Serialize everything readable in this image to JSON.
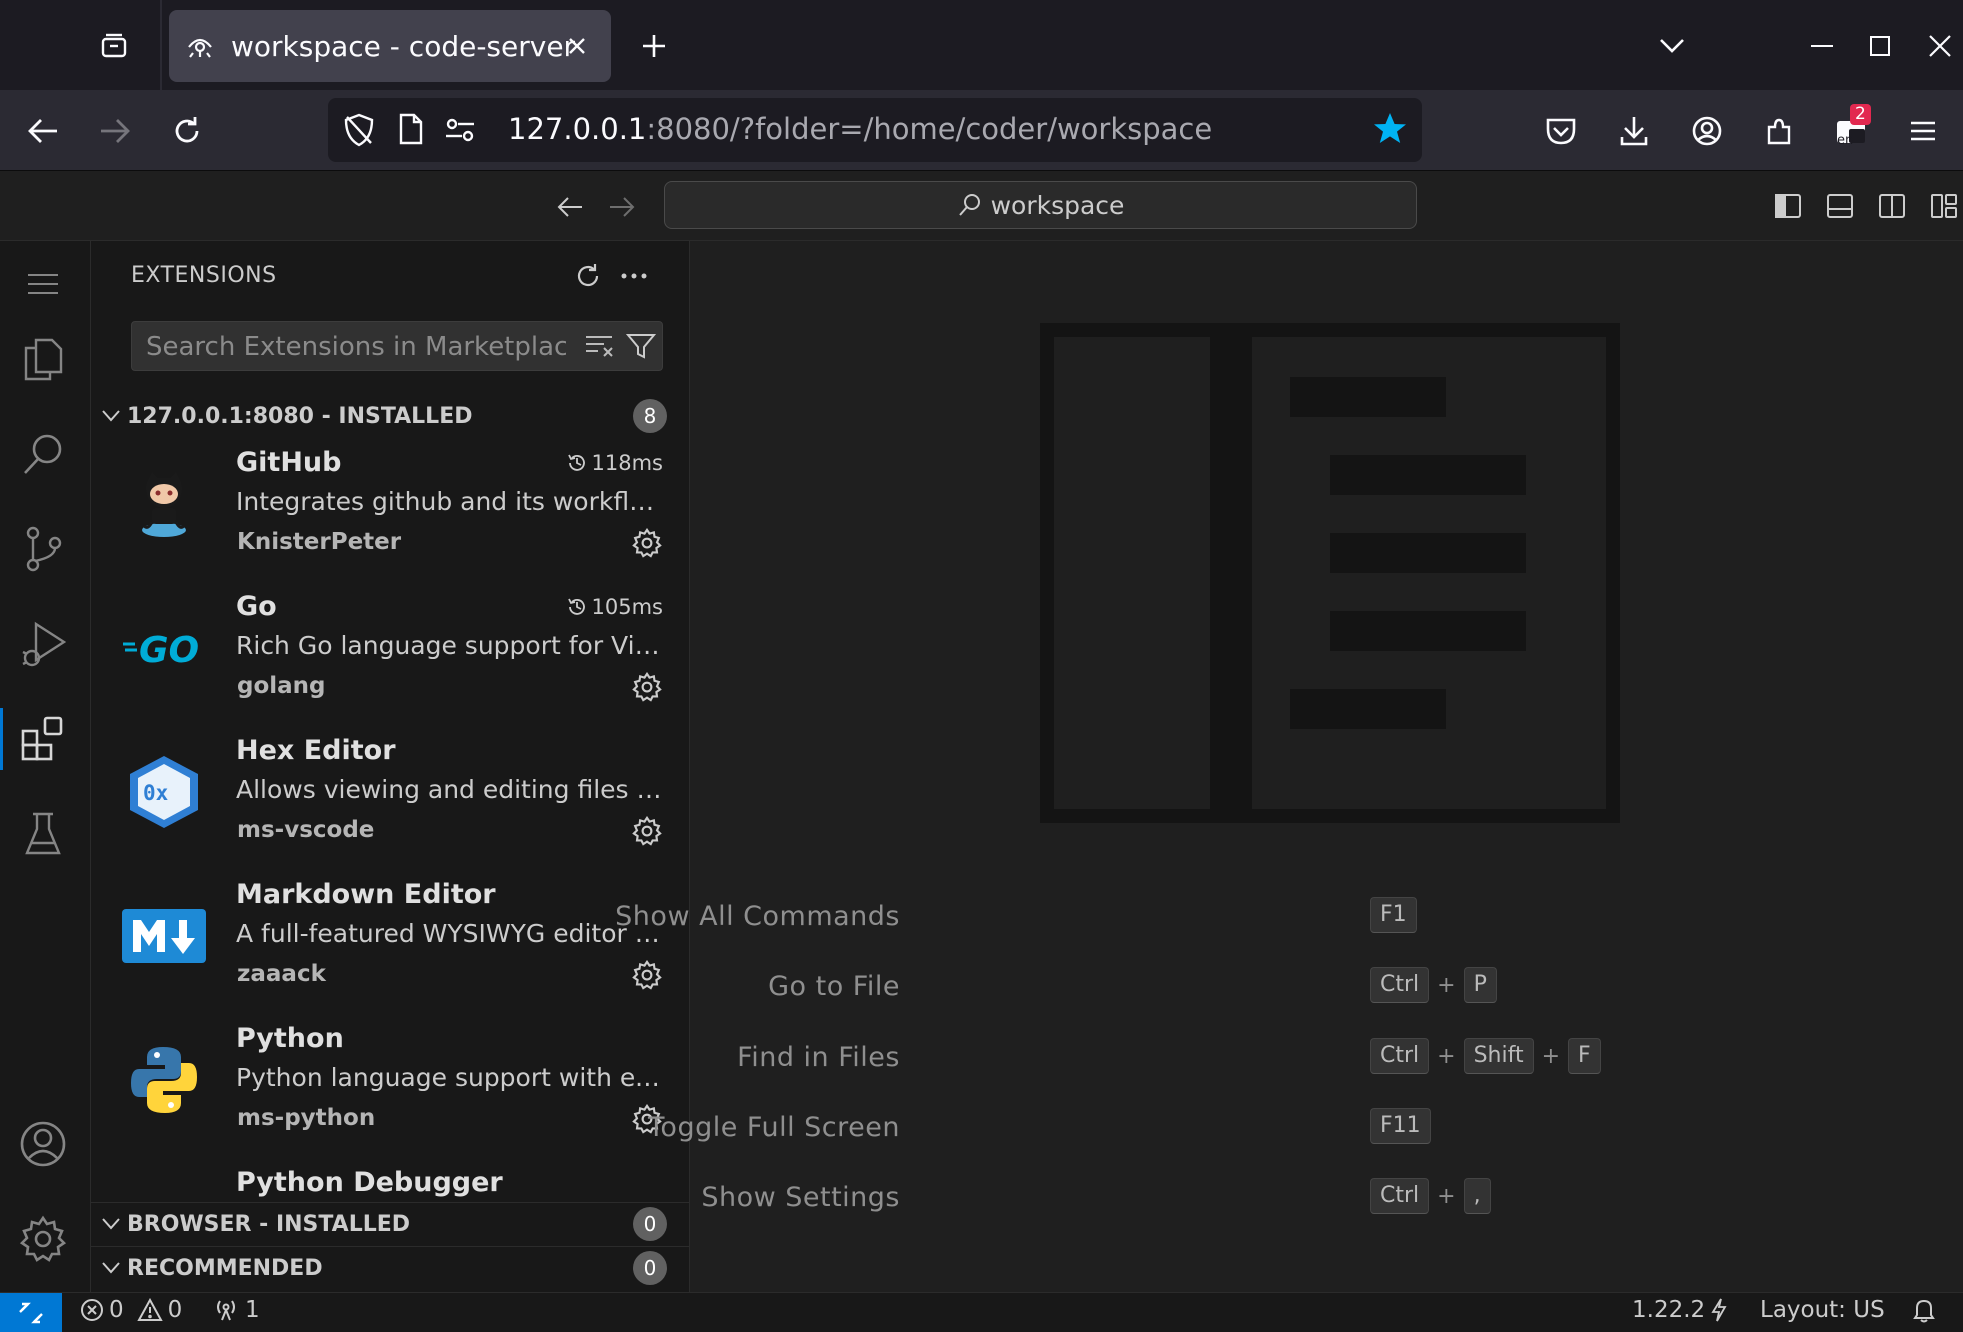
{
  "browser": {
    "tab_title": "workspace - code-server",
    "url_host": "127.0.0.1",
    "url_rest": ":8080/?folder=/home/coder/workspace",
    "extensions_badge": "2",
    "lang_label": "en"
  },
  "titlebar": {
    "command_center": "workspace"
  },
  "sidebar": {
    "title": "EXTENSIONS",
    "search_placeholder": "Search Extensions in Marketplace",
    "installed": {
      "label": "127.0.0.1:8080 - INSTALLED",
      "count": "8"
    },
    "extensions": [
      {
        "name": "GitHub",
        "description": "Integrates github and its workflows into vscode",
        "publisher": "KnisterPeter",
        "time": "118ms",
        "icon": "github-octocat-icon"
      },
      {
        "name": "Go",
        "description": "Rich Go language support for Visual Studio Code",
        "publisher": "golang",
        "time": "105ms",
        "icon": "go-logo-icon"
      },
      {
        "name": "Hex Editor",
        "description": "Allows viewing and editing files in a hex editor",
        "publisher": "ms-vscode",
        "time": "",
        "icon": "hex-editor-icon"
      },
      {
        "name": "Markdown Editor",
        "description": "A full-featured WYSIWYG editor for markdown",
        "publisher": "zaaack",
        "time": "",
        "icon": "markdown-icon"
      },
      {
        "name": "Python",
        "description": "Python language support with extension access points",
        "publisher": "ms-python",
        "time": "",
        "icon": "python-icon"
      },
      {
        "name": "Python Debugger",
        "description": "",
        "publisher": "",
        "time": "",
        "icon": "python-debugger-icon"
      }
    ],
    "hex_icon_text": "0x",
    "browser_installed": {
      "label": "BROWSER - INSTALLED",
      "count": "0"
    },
    "recommended": {
      "label": "RECOMMENDED",
      "count": "0"
    }
  },
  "editor": {
    "shortcuts": [
      {
        "label": "Show All Commands",
        "keys": [
          "F1"
        ]
      },
      {
        "label": "Go to File",
        "keys": [
          "Ctrl",
          "P"
        ]
      },
      {
        "label": "Find in Files",
        "keys": [
          "Ctrl",
          "Shift",
          "F"
        ]
      },
      {
        "label": "Toggle Full Screen",
        "keys": [
          "F11"
        ]
      },
      {
        "label": "Show Settings",
        "keys": [
          "Ctrl",
          ","
        ]
      }
    ]
  },
  "statusbar": {
    "errors": "0",
    "warnings": "0",
    "ports": "1",
    "version": "1.22.2",
    "layout": "Layout: US"
  },
  "colors": {
    "accent": "#0078d4",
    "star": "#00b3f4",
    "badge": "#e22850"
  }
}
